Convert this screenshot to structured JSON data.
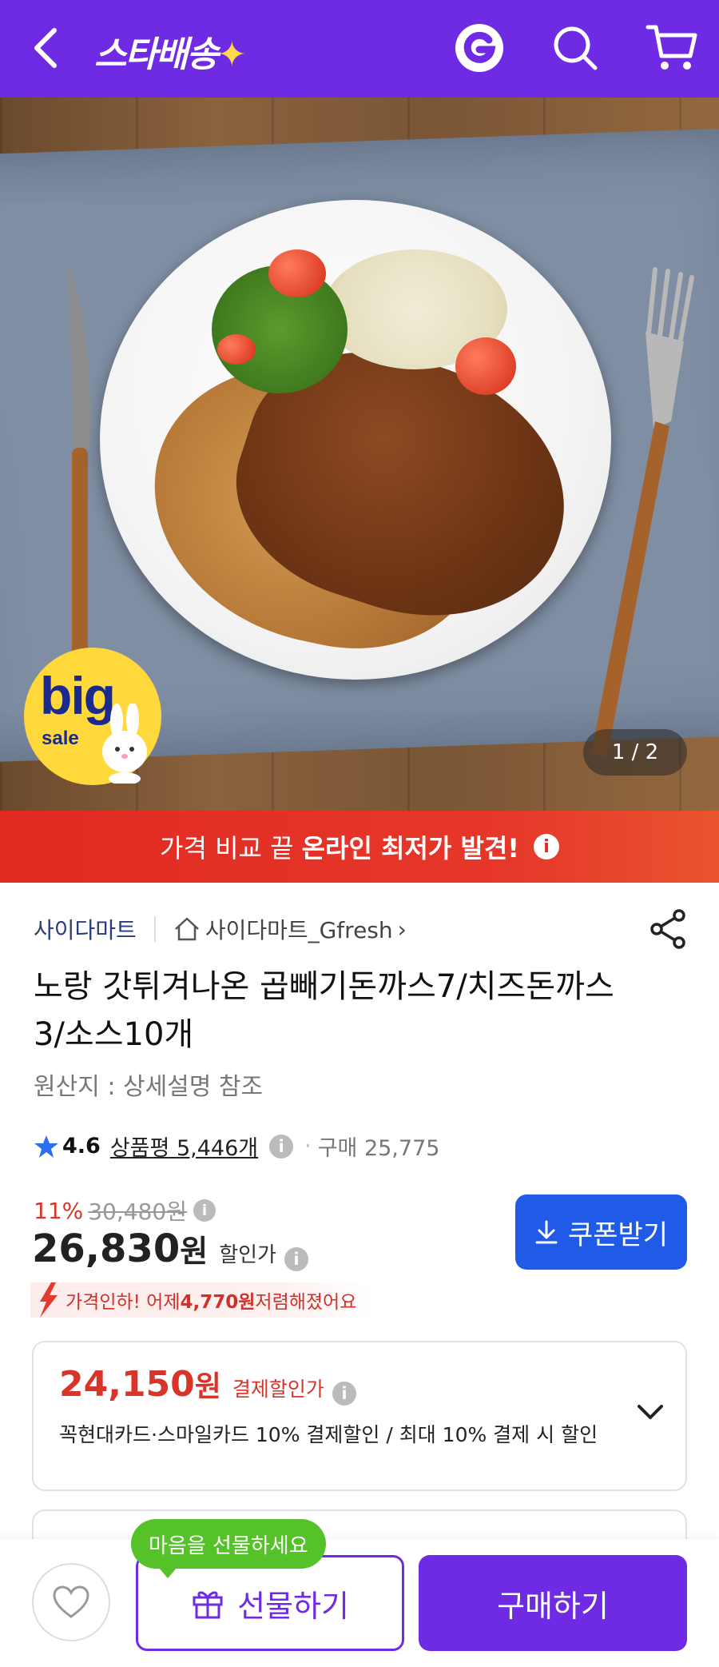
{
  "header": {
    "logo_text": "스타배송",
    "logo_spark": "✦",
    "colors": {
      "bar": "#6f2be3"
    }
  },
  "hero": {
    "counter": "1 / 2",
    "badge_big": "big",
    "badge_sale": "sale"
  },
  "banner": {
    "prefix": "가격 비교 끝",
    "strong": "온라인 최저가 발견!",
    "info": "i",
    "color": "#e12a22"
  },
  "seller": {
    "name": "사이다마트",
    "store": "사이다마트_Gfresh",
    "store_arrow": "›"
  },
  "product": {
    "title": "노랑 갓튀겨나온 곱빼기돈까스7/치즈돈까스3/소스10개",
    "origin": "원산지 : 상세설명 참조"
  },
  "rating": {
    "score": "4.6",
    "reviews": "상품평 5,446개",
    "info": "i",
    "dot": "·",
    "purchases": "구매 25,775"
  },
  "price": {
    "discount_pct": "11%",
    "original": "30,480원",
    "info": "i",
    "sale": "26,830",
    "won": "원",
    "sale_label": "할인가",
    "coupon_button": "쿠폰받기"
  },
  "price_drop": {
    "text_pre": "가격인하! 어제 ",
    "amount": "4,770원",
    "text_post": " 저렴해졌어요"
  },
  "payment": {
    "price": "24,150",
    "won": "원",
    "label": "결제할인가",
    "info": "i",
    "description": "꼭현대카드·스마일카드 10% 결제할인 / 최대 10% 결제 시 할인"
  },
  "bottom": {
    "gift_tooltip": "마음을 선물하세요",
    "gift_button": "선물하기",
    "buy_button": "구매하기"
  }
}
